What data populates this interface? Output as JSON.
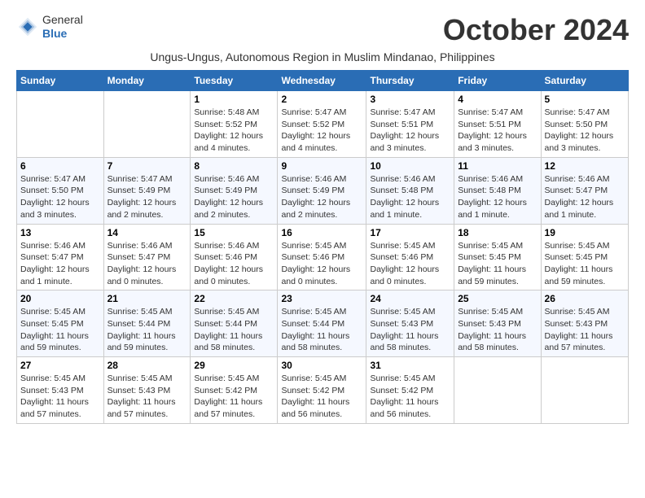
{
  "logo": {
    "general": "General",
    "blue": "Blue"
  },
  "title": "October 2024",
  "subtitle": "Ungus-Ungus, Autonomous Region in Muslim Mindanao, Philippines",
  "weekdays": [
    "Sunday",
    "Monday",
    "Tuesday",
    "Wednesday",
    "Thursday",
    "Friday",
    "Saturday"
  ],
  "weeks": [
    [
      {
        "day": "",
        "info": ""
      },
      {
        "day": "",
        "info": ""
      },
      {
        "day": "1",
        "info": "Sunrise: 5:48 AM\nSunset: 5:52 PM\nDaylight: 12 hours and 4 minutes."
      },
      {
        "day": "2",
        "info": "Sunrise: 5:47 AM\nSunset: 5:52 PM\nDaylight: 12 hours and 4 minutes."
      },
      {
        "day": "3",
        "info": "Sunrise: 5:47 AM\nSunset: 5:51 PM\nDaylight: 12 hours and 3 minutes."
      },
      {
        "day": "4",
        "info": "Sunrise: 5:47 AM\nSunset: 5:51 PM\nDaylight: 12 hours and 3 minutes."
      },
      {
        "day": "5",
        "info": "Sunrise: 5:47 AM\nSunset: 5:50 PM\nDaylight: 12 hours and 3 minutes."
      }
    ],
    [
      {
        "day": "6",
        "info": "Sunrise: 5:47 AM\nSunset: 5:50 PM\nDaylight: 12 hours and 3 minutes."
      },
      {
        "day": "7",
        "info": "Sunrise: 5:47 AM\nSunset: 5:49 PM\nDaylight: 12 hours and 2 minutes."
      },
      {
        "day": "8",
        "info": "Sunrise: 5:46 AM\nSunset: 5:49 PM\nDaylight: 12 hours and 2 minutes."
      },
      {
        "day": "9",
        "info": "Sunrise: 5:46 AM\nSunset: 5:49 PM\nDaylight: 12 hours and 2 minutes."
      },
      {
        "day": "10",
        "info": "Sunrise: 5:46 AM\nSunset: 5:48 PM\nDaylight: 12 hours and 1 minute."
      },
      {
        "day": "11",
        "info": "Sunrise: 5:46 AM\nSunset: 5:48 PM\nDaylight: 12 hours and 1 minute."
      },
      {
        "day": "12",
        "info": "Sunrise: 5:46 AM\nSunset: 5:47 PM\nDaylight: 12 hours and 1 minute."
      }
    ],
    [
      {
        "day": "13",
        "info": "Sunrise: 5:46 AM\nSunset: 5:47 PM\nDaylight: 12 hours and 1 minute."
      },
      {
        "day": "14",
        "info": "Sunrise: 5:46 AM\nSunset: 5:47 PM\nDaylight: 12 hours and 0 minutes."
      },
      {
        "day": "15",
        "info": "Sunrise: 5:46 AM\nSunset: 5:46 PM\nDaylight: 12 hours and 0 minutes."
      },
      {
        "day": "16",
        "info": "Sunrise: 5:45 AM\nSunset: 5:46 PM\nDaylight: 12 hours and 0 minutes."
      },
      {
        "day": "17",
        "info": "Sunrise: 5:45 AM\nSunset: 5:46 PM\nDaylight: 12 hours and 0 minutes."
      },
      {
        "day": "18",
        "info": "Sunrise: 5:45 AM\nSunset: 5:45 PM\nDaylight: 11 hours and 59 minutes."
      },
      {
        "day": "19",
        "info": "Sunrise: 5:45 AM\nSunset: 5:45 PM\nDaylight: 11 hours and 59 minutes."
      }
    ],
    [
      {
        "day": "20",
        "info": "Sunrise: 5:45 AM\nSunset: 5:45 PM\nDaylight: 11 hours and 59 minutes."
      },
      {
        "day": "21",
        "info": "Sunrise: 5:45 AM\nSunset: 5:44 PM\nDaylight: 11 hours and 59 minutes."
      },
      {
        "day": "22",
        "info": "Sunrise: 5:45 AM\nSunset: 5:44 PM\nDaylight: 11 hours and 58 minutes."
      },
      {
        "day": "23",
        "info": "Sunrise: 5:45 AM\nSunset: 5:44 PM\nDaylight: 11 hours and 58 minutes."
      },
      {
        "day": "24",
        "info": "Sunrise: 5:45 AM\nSunset: 5:43 PM\nDaylight: 11 hours and 58 minutes."
      },
      {
        "day": "25",
        "info": "Sunrise: 5:45 AM\nSunset: 5:43 PM\nDaylight: 11 hours and 58 minutes."
      },
      {
        "day": "26",
        "info": "Sunrise: 5:45 AM\nSunset: 5:43 PM\nDaylight: 11 hours and 57 minutes."
      }
    ],
    [
      {
        "day": "27",
        "info": "Sunrise: 5:45 AM\nSunset: 5:43 PM\nDaylight: 11 hours and 57 minutes."
      },
      {
        "day": "28",
        "info": "Sunrise: 5:45 AM\nSunset: 5:43 PM\nDaylight: 11 hours and 57 minutes."
      },
      {
        "day": "29",
        "info": "Sunrise: 5:45 AM\nSunset: 5:42 PM\nDaylight: 11 hours and 57 minutes."
      },
      {
        "day": "30",
        "info": "Sunrise: 5:45 AM\nSunset: 5:42 PM\nDaylight: 11 hours and 56 minutes."
      },
      {
        "day": "31",
        "info": "Sunrise: 5:45 AM\nSunset: 5:42 PM\nDaylight: 11 hours and 56 minutes."
      },
      {
        "day": "",
        "info": ""
      },
      {
        "day": "",
        "info": ""
      }
    ]
  ]
}
